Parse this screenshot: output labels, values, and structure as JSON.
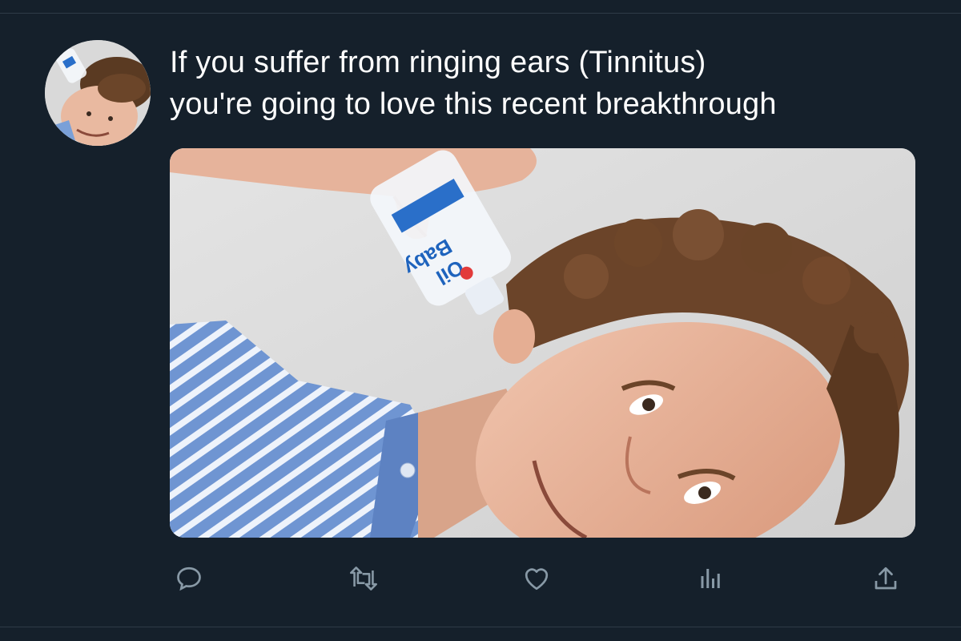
{
  "tweet": {
    "text_line_1": "If you suffer from ringing ears (Tinnitus)",
    "text_line_2": "you're going to love this recent breakthrough"
  },
  "media": {
    "bottle_label_word1": "Baby",
    "bottle_label_word2": "Oil"
  },
  "actions": {
    "icons": [
      "reply-icon",
      "retweet-icon",
      "like-icon",
      "analytics-icon",
      "share-icon"
    ]
  },
  "colors": {
    "background": "#15202b",
    "text": "#ffffff",
    "icon": "#8899a6",
    "divider": "#2f3b47"
  }
}
